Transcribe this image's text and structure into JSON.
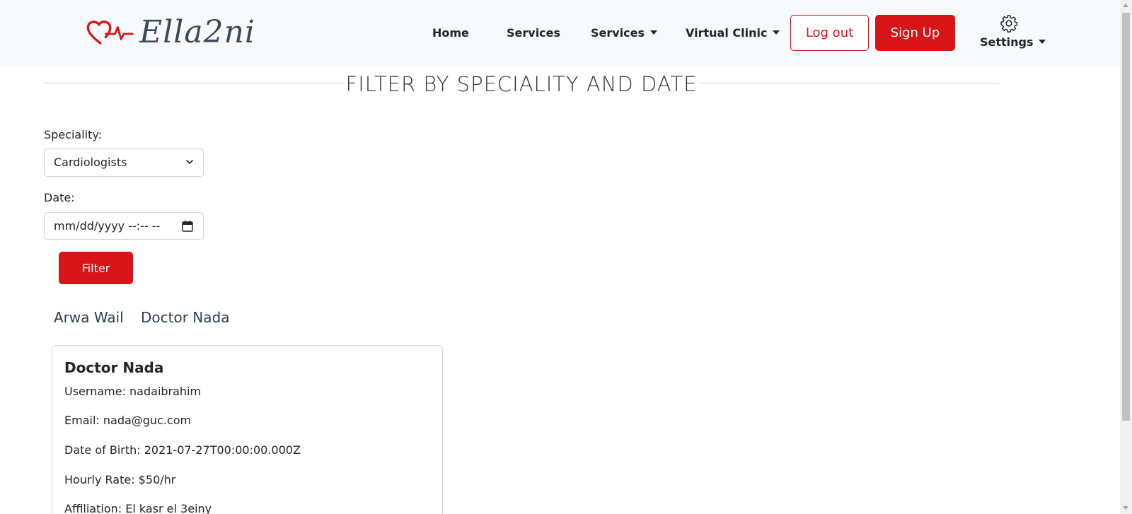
{
  "brand": {
    "logo_text": "Ella2ni",
    "accent_color": "#d81418",
    "icon": "heart-pulse-icon"
  },
  "nav": {
    "home": "Home",
    "services": "Services",
    "services_dropdown": "Services",
    "virtual_clinic": "Virtual Clinic",
    "logout": "Log out",
    "signup": "Sign Up",
    "settings": "Settings",
    "settings_icon": "gear-icon"
  },
  "filter": {
    "title": "FILTER BY SPECIALITY AND DATE",
    "speciality_label": "Speciality:",
    "speciality_value": "Cardiologists",
    "date_label": "Date:",
    "date_placeholder": "mm/dd/yyyy --:-- --",
    "filter_button": "Filter"
  },
  "doctor_tabs": [
    "Arwa Wail",
    "Doctor Nada"
  ],
  "doctor_card": {
    "name": "Doctor Nada",
    "username": "Username: nadaibrahim",
    "email": "Email: nada@guc.com",
    "dob": "Date of Birth: 2021-07-27T00:00:00.000Z",
    "rate": "Hourly Rate: $50/hr",
    "affiliation": "Affiliation: El kasr el 3einy"
  }
}
